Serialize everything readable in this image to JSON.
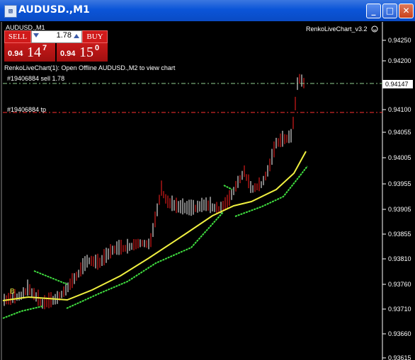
{
  "window": {
    "title": "AUDUSD.,M1",
    "buttons": {
      "minimize": "_",
      "maximize": "□",
      "close": "✕"
    }
  },
  "chart": {
    "symbol_label": "AUDUSD.,M1",
    "indicator_label": "RenkoLiveChart_v3.2",
    "info_line": "RenkoLiveChart(1): Open Offline AUDUSD.,M2 to view chart",
    "order_line": "#19406884 sell 1.78",
    "tp_line": "#19406884 tp",
    "current_price": "0.94147",
    "marker": "B"
  },
  "ticket": {
    "sell_label": "SELL",
    "buy_label": "BUY",
    "lot": "1.78",
    "sell_price": {
      "prefix": "0.94",
      "big": "14",
      "sup": "7"
    },
    "buy_price": {
      "prefix": "0.94",
      "big": "15",
      "sup": "0"
    }
  },
  "price_axis": {
    "ticks": [
      "0.94250",
      "0.94200",
      "0.94147",
      "0.94100",
      "0.94055",
      "0.94005",
      "0.93955",
      "0.93905",
      "0.93855",
      "0.93810",
      "0.93760",
      "0.93710",
      "0.93660",
      "0.93615"
    ]
  },
  "colors": {
    "up_candle": "#ffffff",
    "down_candle": "#ff2020",
    "ma_yellow": "#f0f040",
    "ma_green": "#40e040",
    "order_line": "#90d090",
    "tp_line": "#ff3030"
  }
}
